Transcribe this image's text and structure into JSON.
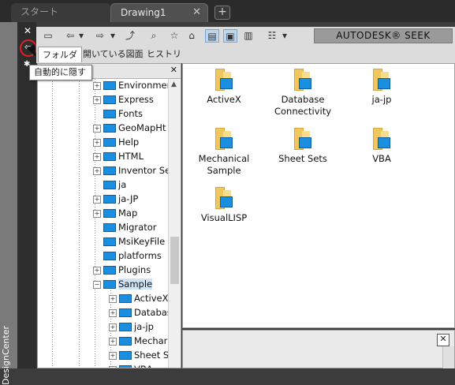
{
  "document_tabs": [
    {
      "label": "スタート"
    },
    {
      "label": "Drawing1",
      "close": "✕"
    }
  ],
  "new_tab": "+",
  "palette_title": "DesignCenter",
  "palette_strip": {
    "close": "✕",
    "autohide": "⇦"
  },
  "toolbar": {
    "buttons": [
      {
        "icon": "load-folder-icon",
        "glyph": "📂"
      },
      {
        "icon": "back-icon",
        "glyph": "⇦"
      },
      {
        "icon": "dropdown-icon",
        "glyph": "▾"
      },
      {
        "icon": "forward-icon",
        "glyph": "⇨"
      },
      {
        "icon": "dropdown-icon",
        "glyph": "▾"
      },
      {
        "icon": "up-folder-icon",
        "glyph": "⤴"
      },
      {
        "icon": "search-icon",
        "glyph": "🔍"
      },
      {
        "icon": "favorites-icon",
        "glyph": "★"
      },
      {
        "icon": "home-icon",
        "glyph": "⌂"
      },
      {
        "icon": "tree-view-toggle-icon",
        "glyph": "▤"
      },
      {
        "icon": "preview-icon",
        "glyph": "▣"
      },
      {
        "icon": "description-icon",
        "glyph": "▥"
      },
      {
        "icon": "views-icon",
        "glyph": "☷"
      },
      {
        "icon": "views-dropdown-icon",
        "glyph": "▾"
      }
    ],
    "seek_label": "AUTODESK® SEEK"
  },
  "panel_tabs": [
    {
      "label": "フォルダ",
      "selected": true
    },
    {
      "label": "開いている図面",
      "selected": false
    },
    {
      "label": "ヒストリ",
      "selected": false
    }
  ],
  "tooltip": "自動的に隠す",
  "tree": {
    "close": "✕",
    "items": [
      {
        "label": "Environmen",
        "level": 1,
        "expander": "+"
      },
      {
        "label": "Express",
        "level": 1,
        "expander": "+"
      },
      {
        "label": "Fonts",
        "level": 1,
        "expander": ""
      },
      {
        "label": "GeoMapHt",
        "level": 1,
        "expander": "+"
      },
      {
        "label": "Help",
        "level": 1,
        "expander": "+"
      },
      {
        "label": "HTML",
        "level": 1,
        "expander": "+"
      },
      {
        "label": "Inventor Se",
        "level": 1,
        "expander": "+"
      },
      {
        "label": "ja",
        "level": 1,
        "expander": ""
      },
      {
        "label": "ja-JP",
        "level": 1,
        "expander": "+"
      },
      {
        "label": "Map",
        "level": 1,
        "expander": "+"
      },
      {
        "label": "Migrator",
        "level": 1,
        "expander": ""
      },
      {
        "label": "MsiKeyFile",
        "level": 1,
        "expander": ""
      },
      {
        "label": "platforms",
        "level": 1,
        "expander": ""
      },
      {
        "label": "Plugins",
        "level": 1,
        "expander": "+"
      },
      {
        "label": "Sample",
        "level": 1,
        "expander": "−",
        "selected": true
      },
      {
        "label": "ActiveX",
        "level": 2,
        "expander": "+"
      },
      {
        "label": "Databas",
        "level": 2,
        "expander": "+"
      },
      {
        "label": "ja-jp",
        "level": 2,
        "expander": "+"
      },
      {
        "label": "Mechar",
        "level": 2,
        "expander": "+"
      },
      {
        "label": "Sheet Se",
        "level": 2,
        "expander": "+"
      },
      {
        "label": "VBA",
        "level": 2,
        "expander": "+"
      }
    ]
  },
  "content_items": [
    {
      "label": "ActiveX"
    },
    {
      "label": "Database Connectivity"
    },
    {
      "label": "ja-jp"
    },
    {
      "label": "Mechanical Sample"
    },
    {
      "label": "Sheet Sets"
    },
    {
      "label": "VBA"
    },
    {
      "label": "VisualLISP"
    }
  ],
  "preview_close": "✕"
}
